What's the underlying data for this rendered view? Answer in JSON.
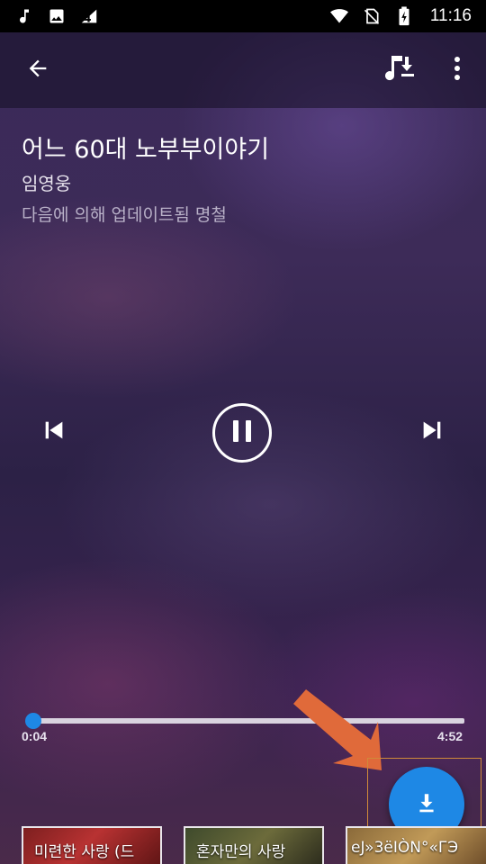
{
  "status_bar": {
    "time": "11:16",
    "left_icons": [
      "music-note-icon",
      "image-icon",
      "signal-4-icon"
    ],
    "right_icons": [
      "wifi-icon",
      "no-sim-icon",
      "battery-charging-icon"
    ]
  },
  "toolbar": {
    "back_icon": "arrow-back-icon",
    "download_music_icon": "music-download-icon",
    "more_icon": "more-vertical-icon"
  },
  "song": {
    "title": "어느 60대 노부부이야기",
    "artist": "임영웅",
    "updated_by": "다음에 의해 업데이트됨 명철"
  },
  "playback": {
    "current_time": "0:04",
    "total_time": "4:52",
    "progress": 0.0137,
    "state": "playing",
    "accent_color": "#1e88e5"
  },
  "fab": {
    "icon": "download-icon",
    "color": "#1e88e5"
  },
  "annotation": {
    "arrow_color": "#e06a3a",
    "highlight_color": "#d08a3a"
  },
  "related": [
    {
      "label": "미련한 사랑 (드"
    },
    {
      "label": "혼자만의 사랑"
    },
    {
      "label": "eJ»3ëIÒN°«ГЭ"
    }
  ]
}
